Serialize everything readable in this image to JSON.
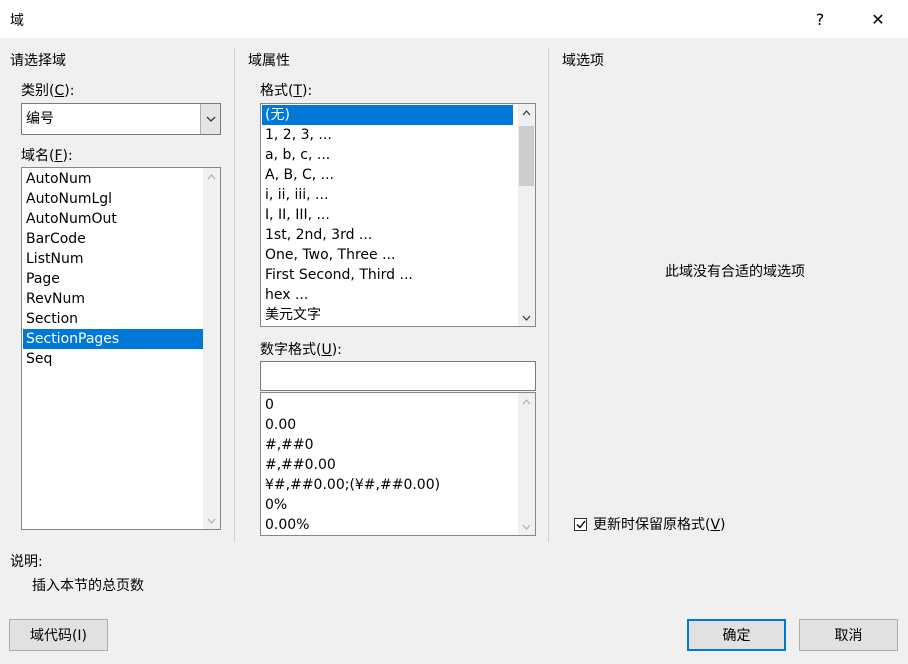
{
  "window": {
    "title": "域",
    "help_glyph": "?",
    "close_glyph": "✕"
  },
  "left": {
    "section_title": "请选择域",
    "category_label_prefix": "类别(",
    "category_label_key": "C",
    "category_label_suffix": "):",
    "category_value": "编号",
    "fieldname_label_prefix": "域名(",
    "fieldname_label_key": "F",
    "fieldname_label_suffix": "):",
    "fields": [
      "AutoNum",
      "AutoNumLgl",
      "AutoNumOut",
      "BarCode",
      "ListNum",
      "Page",
      "RevNum",
      "Section",
      "SectionPages",
      "Seq"
    ],
    "selected_field": "SectionPages"
  },
  "middle": {
    "section_title": "域属性",
    "format_label_prefix": "格式(",
    "format_label_key": "T",
    "format_label_suffix": "):",
    "formats": [
      "(无)",
      "1, 2, 3, ...",
      "a, b, c, ...",
      "A, B, C, ...",
      "i, ii, iii, ...",
      "I, II, III, ...",
      "1st, 2nd, 3rd ...",
      "One, Two, Three ...",
      "First Second, Third ...",
      "hex ...",
      "美元文字"
    ],
    "selected_format": "(无)",
    "numformat_label_prefix": "数字格式(",
    "numformat_label_key": "U",
    "numformat_label_suffix": "):",
    "numformat_value": "",
    "numformats": [
      "0",
      "0.00",
      "#,##0",
      "#,##0.00",
      "¥#,##0.00;(¥#,##0.00)",
      "0%",
      "0.00%"
    ]
  },
  "right": {
    "section_title": "域选项",
    "empty_message": "此域没有合适的域选项",
    "preserve_label_prefix": "更新时保留原格式(",
    "preserve_label_key": "V",
    "preserve_label_suffix": ")",
    "preserve_checked": true
  },
  "description": {
    "label": "说明:",
    "text": "插入本节的总页数"
  },
  "buttons": {
    "field_codes": "域代码(I)",
    "ok": "确定",
    "cancel": "取消"
  },
  "colors": {
    "selection": "#0078d7",
    "default_border": "#0078d7"
  }
}
